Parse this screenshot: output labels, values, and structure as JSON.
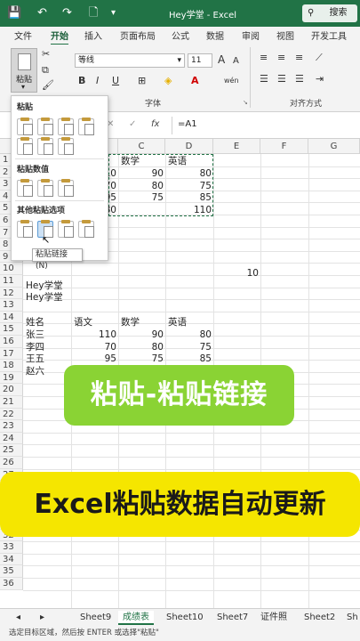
{
  "titlebar": {
    "title": "Hey学堂  -  Excel",
    "search_label": "搜索"
  },
  "tabs": [
    "文件",
    "开始",
    "插入",
    "页面布局",
    "公式",
    "数据",
    "审阅",
    "视图",
    "开发工具"
  ],
  "ribbon": {
    "paste_label": "粘贴",
    "font_name": "等线",
    "font_size": "11",
    "font_group_label": "字体",
    "align_group_label": "对齐方式",
    "bold": "B",
    "italic": "I",
    "underline": "U",
    "grow_font": "A",
    "shrink_font": "A"
  },
  "formula_bar": {
    "fx": "fx",
    "cancel": "✕",
    "confirm": "✓",
    "formula": "=A1"
  },
  "grid": {
    "columns": [
      "A",
      "B",
      "C",
      "D",
      "E",
      "F",
      "G"
    ],
    "rows": [
      "1",
      "2",
      "3",
      "4",
      "5",
      "6",
      "7",
      "8",
      "9",
      "10",
      "11",
      "12",
      "13",
      "14",
      "15",
      "16",
      "17",
      "18",
      "19",
      "20",
      "21",
      "22",
      "23",
      "24",
      "25",
      "26",
      "27",
      "28",
      "29",
      "30",
      "31",
      "32",
      "33",
      "34",
      "35",
      "36"
    ],
    "copied_block": {
      "header": [
        "",
        "数学",
        "英语"
      ],
      "rows": [
        [
          "10",
          "90",
          "80"
        ],
        [
          "70",
          "80",
          "75"
        ],
        [
          "95",
          "75",
          "85"
        ],
        [
          "80",
          "",
          "110"
        ]
      ]
    },
    "e10": "10",
    "a11": "Hey学堂",
    "a12": "Hey学堂",
    "table_header": [
      "姓名",
      "语文",
      "数学",
      "英语"
    ],
    "table_rows": [
      [
        "张三",
        "110",
        "90",
        "80"
      ],
      [
        "李四",
        "70",
        "80",
        "75"
      ],
      [
        "王五",
        "95",
        "75",
        "85"
      ],
      [
        "赵六",
        "",
        "",
        ""
      ]
    ]
  },
  "paste_menu": {
    "section1": "粘贴",
    "section2": "粘贴数值",
    "section3": "其他粘贴选项",
    "tooltip": "粘贴链接 (N)"
  },
  "banner1": "粘贴-粘贴链接",
  "banner2": "Excel粘贴数据自动更新",
  "sheet_tabs": [
    "Sheet9",
    "成绩表",
    "Sheet10",
    "Sheet7",
    "证件照",
    "Sheet2",
    "Sh"
  ],
  "active_sheet": "成绩表",
  "status": "选定目标区域，然后按 ENTER 或选择\"粘贴\"",
  "colors": {
    "excel_green": "#217346",
    "banner_green": "#8ad334",
    "banner_yellow": "#f5e600"
  }
}
